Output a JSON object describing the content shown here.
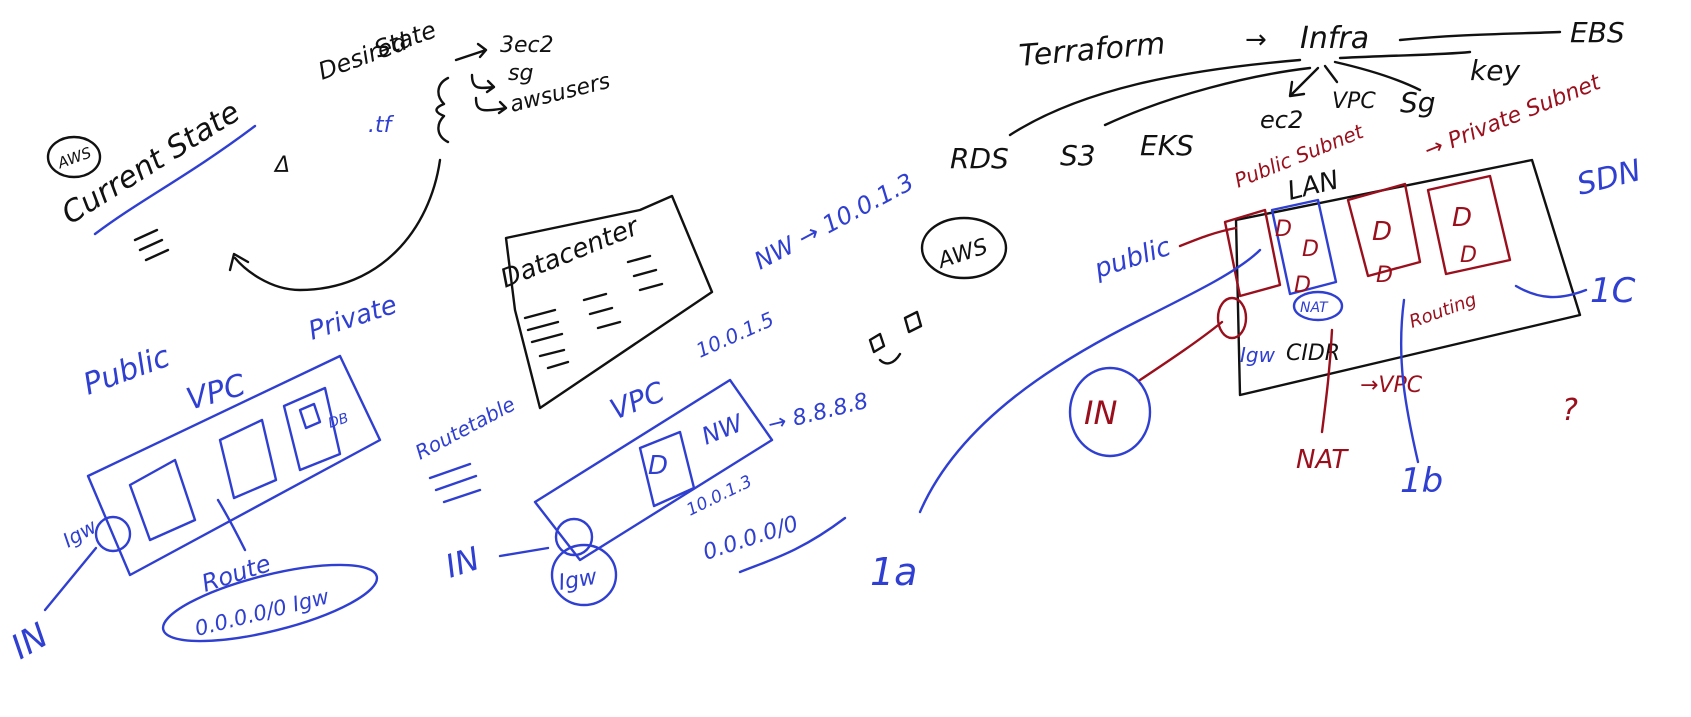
{
  "colors": {
    "ink_black": "#111111",
    "ink_blue": "#2f3fd1",
    "ink_red": "#9a0f1c",
    "background": "#ffffff"
  },
  "state_sketch": {
    "aws_badge": "AWS",
    "current_state": "Current State",
    "delta": "Δ",
    "desired_state_line1": "Desired",
    "desired_state_line2": "State",
    "tf_file": ".tf",
    "items": [
      "3ec2",
      "sg",
      "awsusers"
    ]
  },
  "terraform_sketch": {
    "terraform": "Terraform",
    "arrow": "→",
    "infra": "Infra",
    "resources": [
      "RDS",
      "S3",
      "EKS",
      "ec2",
      "VPC",
      "Sg",
      "key",
      "EBS"
    ]
  },
  "datacenter_sketch": {
    "label": "Datacenter",
    "nw_ip": "NW → 10.0.1.3"
  },
  "vpc_left": {
    "public": "Public",
    "vpc": "VPC",
    "private": "Private",
    "db": "DB",
    "igw": "Igw",
    "in": "IN",
    "route": "Route",
    "route_entry": "0.0.0.0/0   Igw",
    "route_table": "Routetable"
  },
  "vpc_middle": {
    "ip_top": "10.0.1.5",
    "vpc": "VPC",
    "nw": "NW",
    "dest": "→ 8.8.8.8",
    "ip_bottom": "10.0.1.3",
    "cidr": "0.0.0.0/0",
    "in": "IN",
    "igw": "Igw"
  },
  "aws_right": {
    "aws_badge": "AWS",
    "lan": "LAN",
    "public_subnet": "Public Subnet",
    "private_subnet": "→ Private Subnet",
    "sdn": "SDN",
    "public": "public",
    "nat_gw": "NAT",
    "igw": "Igw",
    "cidr": "CIDR",
    "routing": "Routing",
    "vpc": "→VPC",
    "nat": "NAT",
    "in": "IN",
    "label_1a": "1a",
    "label_1b": "1b",
    "label_1c": "1C",
    "question": "?",
    "db_marks": [
      "D",
      "D",
      "D",
      "D",
      "D",
      "D",
      "D"
    ]
  }
}
